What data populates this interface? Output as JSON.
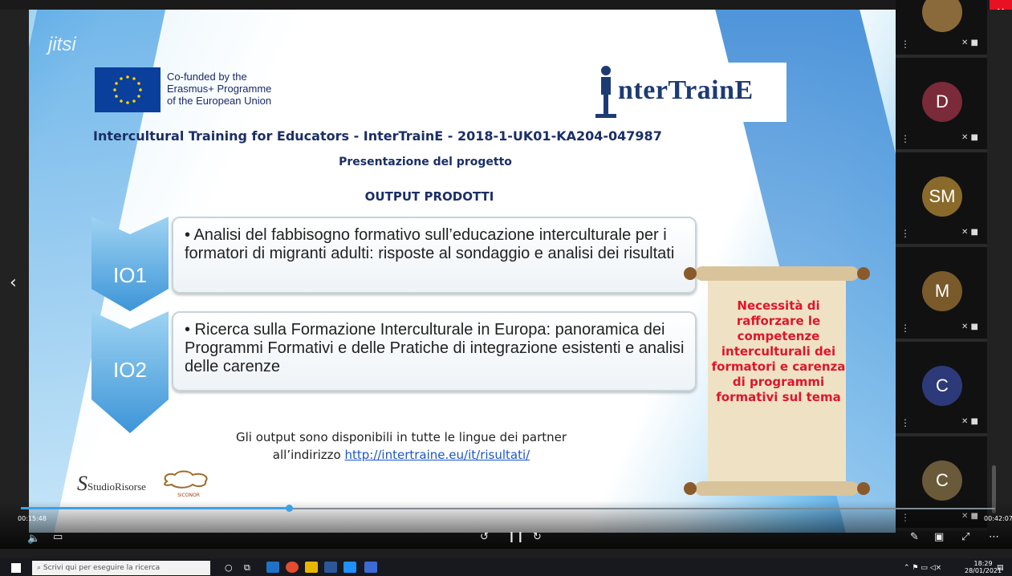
{
  "window": {
    "back_icon": "arrow-left-icon",
    "minimize": "–",
    "maximize": "▫",
    "close": "✕"
  },
  "slide": {
    "watermark": "jitsi",
    "eu": {
      "line1": "Co-funded by the",
      "line2": "Erasmus+ Programme",
      "line3": "of the European Union"
    },
    "logo_text": "nterTrainE",
    "title": "Intercultural Training for Educators - InterTrainE - 2018-1-UK01-KA204-047987",
    "subtitle": "Presentazione del progetto",
    "heading": "OUTPUT PRODOTTI",
    "outputs": [
      {
        "label": "IO1",
        "text": "• Analisi del fabbisogno formativo sull’educazione interculturale per i formatori di migranti adulti: risposte al sondaggio e analisi dei risultati"
      },
      {
        "label": "IO2",
        "text": "• Ricerca sulla Formazione Interculturale in Europa: panoramica dei Programmi Formativi e delle Pratiche di integrazione esistenti e analisi delle carenze"
      }
    ],
    "availability_line1": "Gli output sono disponibili in tutte le lingue dei partner",
    "availability_prefix": "all’indirizzo ",
    "availability_link": "http://intertraine.eu/it/risultati/",
    "scroll_note": "Necessità di rafforzare le competenze interculturali dei formatori e carenza di programmi formativi sul tema",
    "partner1": "StudioRisorse",
    "partner2": "SICONOR"
  },
  "participants": [
    {
      "initials": "",
      "color": "#8a6a3a"
    },
    {
      "initials": "D",
      "color": "#7a2a38"
    },
    {
      "initials": "SM",
      "color": "#8a6a2a"
    },
    {
      "initials": "M",
      "color": "#7a5a2a"
    },
    {
      "initials": "C",
      "color": "#2d3a7a"
    },
    {
      "initials": "C",
      "color": "#6a5a3a"
    }
  ],
  "player": {
    "elapsed": "00:15:48",
    "total": "00:42:07",
    "progress": 0.275,
    "icons": {
      "volume": "volume-icon",
      "subtitles": "subtitles-icon",
      "rewind": "rewind-10-icon",
      "pause": "pause-icon",
      "forward": "forward-30-icon",
      "pen": "pen-icon",
      "cast": "cast-icon",
      "fullscreen": "fullscreen-icon",
      "more": "more-icon"
    }
  },
  "taskbar": {
    "search_placeholder": "Scrivi qui per eseguire la ricerca",
    "time": "18:29",
    "date": "28/01/2021"
  }
}
